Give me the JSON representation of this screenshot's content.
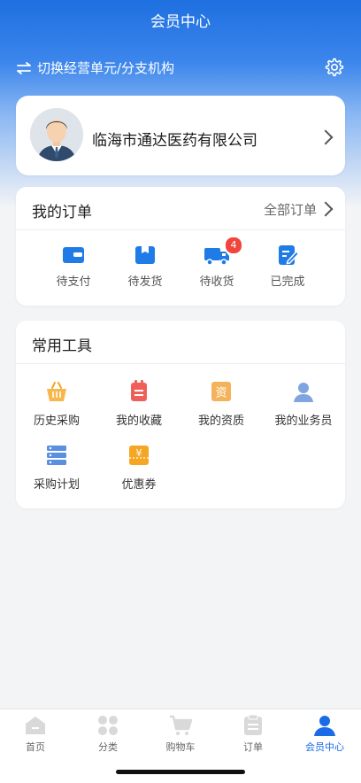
{
  "header": {
    "title": "会员中心",
    "switch_label": "切换经营单元/分支机构"
  },
  "profile": {
    "company": "临海市通达医药有限公司"
  },
  "orders": {
    "title": "我的订单",
    "all_label": "全部订单",
    "items": [
      {
        "label": "待支付",
        "icon": "wallet-icon"
      },
      {
        "label": "待发货",
        "icon": "box-icon"
      },
      {
        "label": "待收货",
        "icon": "truck-icon",
        "badge": "4"
      },
      {
        "label": "已完成",
        "icon": "edit-icon"
      }
    ]
  },
  "tools": {
    "title": "常用工具",
    "items": [
      {
        "label": "历史采购",
        "icon": "basket-icon"
      },
      {
        "label": "我的收藏",
        "icon": "favorite-icon"
      },
      {
        "label": "我的资质",
        "icon": "qualification-icon",
        "icon_text": "资"
      },
      {
        "label": "我的业务员",
        "icon": "salesperson-icon"
      },
      {
        "label": "采购计划",
        "icon": "plan-icon"
      },
      {
        "label": "优惠券",
        "icon": "coupon-icon",
        "icon_text": "¥"
      }
    ]
  },
  "tabbar": {
    "items": [
      {
        "label": "首页",
        "icon": "home-icon"
      },
      {
        "label": "分类",
        "icon": "category-icon"
      },
      {
        "label": "购物车",
        "icon": "cart-icon"
      },
      {
        "label": "订单",
        "icon": "order-icon"
      },
      {
        "label": "会员中心",
        "icon": "member-icon",
        "active": true
      }
    ]
  },
  "colors": {
    "primary": "#1a6be6",
    "badge": "#f0463c",
    "tool_orange": "#f5a623",
    "tool_red": "#f0605a"
  }
}
